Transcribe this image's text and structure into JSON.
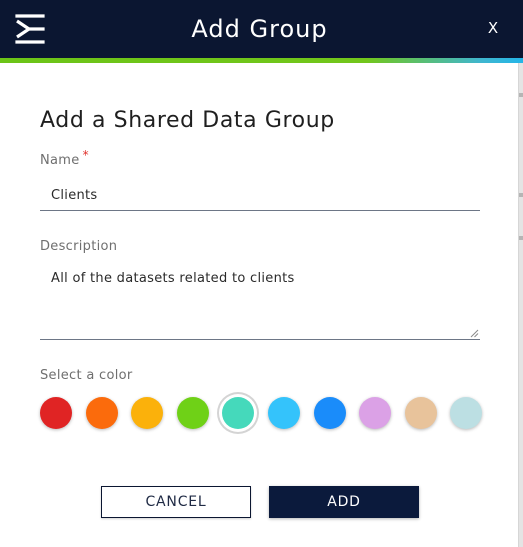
{
  "dialog": {
    "title": "Add Group",
    "close_label": "X",
    "heading": "Add a Shared Data Group"
  },
  "name_field": {
    "label": "Name",
    "required_marker": "*",
    "value": "Clients"
  },
  "description_field": {
    "label": "Description",
    "value": "All of the datasets related to clients"
  },
  "color_picker": {
    "label": "Select a color",
    "selected": "teal",
    "options": [
      {
        "name": "red",
        "color": "#e02424"
      },
      {
        "name": "orange",
        "color": "#fb6b0c"
      },
      {
        "name": "amber",
        "color": "#fbb10b"
      },
      {
        "name": "lime",
        "color": "#6fd117"
      },
      {
        "name": "teal",
        "color": "#45d9bb"
      },
      {
        "name": "sky",
        "color": "#34c3fb"
      },
      {
        "name": "blue",
        "color": "#1a8cfa"
      },
      {
        "name": "lavender",
        "color": "#dba1e6"
      },
      {
        "name": "tan",
        "color": "#e8c39b"
      },
      {
        "name": "pale-blue",
        "color": "#bcdfe3"
      }
    ]
  },
  "buttons": {
    "cancel_label": "CANCEL",
    "add_label": "ADD"
  },
  "colors": {
    "header_bg": "#0b1631",
    "accent_green": "#6cc417",
    "accent_blue": "#23b5e8",
    "primary_button": "#0b1a3c"
  },
  "icons": {
    "logo": "brand-logo-icon",
    "close": "close-icon",
    "resize": "resize-handle-icon"
  }
}
